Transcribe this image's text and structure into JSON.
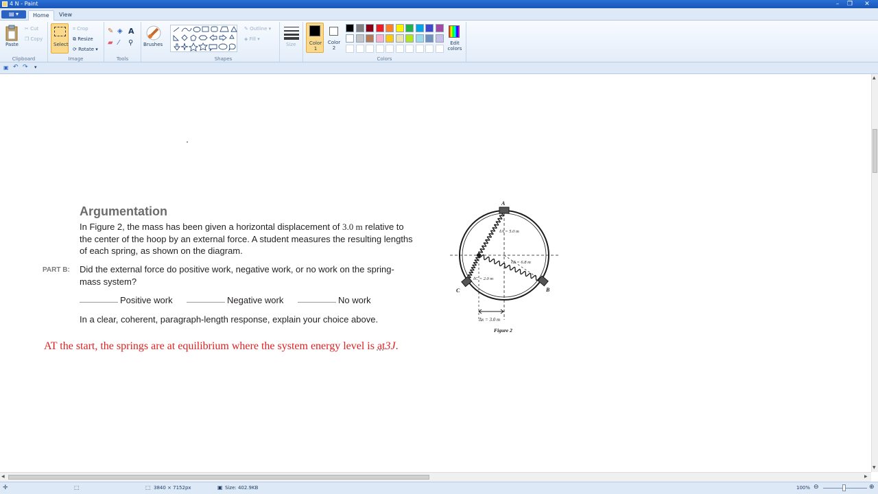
{
  "window": {
    "title": "4 N - Paint"
  },
  "tabs": [
    "Home",
    "View"
  ],
  "ribbon": {
    "clipboard": {
      "paste": "Paste",
      "cut": "Cut",
      "copy": "Copy",
      "label": "Clipboard"
    },
    "image": {
      "select": "Select",
      "crop": "Crop",
      "resize": "Resize",
      "rotate": "Rotate",
      "label": "Image"
    },
    "tools": {
      "label": "Tools"
    },
    "brushes": {
      "label": "Brushes"
    },
    "shapes": {
      "outline": "Outline",
      "fill": "Fill",
      "label": "Shapes"
    },
    "size": {
      "label": "Size"
    },
    "colors": {
      "color1": "Color 1",
      "color2": "Color 2",
      "edit": "Edit colors",
      "label": "Colors",
      "color1_value": "#000000",
      "color2_value": "#ffffff",
      "palette_row1": [
        "#000000",
        "#7f7f7f",
        "#880015",
        "#ed1c24",
        "#ff7f27",
        "#fff200",
        "#22b14c",
        "#00a2e8",
        "#3f48cc",
        "#a349a4"
      ],
      "palette_row2": [
        "#ffffff",
        "#c3c3c3",
        "#b97a57",
        "#ffaec9",
        "#ffc90e",
        "#efe4b0",
        "#b5e61d",
        "#99d9ea",
        "#7092be",
        "#c8bfe7"
      ]
    }
  },
  "document": {
    "heading": "Argumentation",
    "paragraph1": {
      "before": "In Figure 2, the mass has been given a horizontal displacement of",
      "value": "3.0 m",
      "after": "relative to",
      "line2": "the center of the hoop by an external force. A student measures the resulting lengths",
      "line3": "of each spring, as shown on the diagram."
    },
    "part_label": "PART B:",
    "question_line1": "Did the external force do positive work, negative work, or no work on the spring-",
    "question_line2": "mass system?",
    "options": [
      "Positive work",
      "Negative work",
      "No work"
    ],
    "instruction": "In a clear, coherent, paragraph-length response, explain your choice above.",
    "answer": {
      "before": "AT the start, the springs are at equilibrium where the system energy level is",
      "underlined": "at",
      "value": "3J",
      "after": "."
    },
    "figure": {
      "labels": [
        "A",
        "B",
        "C"
      ],
      "lengths": [
        "ℓA = 5.0 m",
        "ℓB = 6.8 m",
        "ℓC = 2.0 m"
      ],
      "displacement": "Δx = 3.0 m",
      "caption": "Figure 2"
    }
  },
  "status": {
    "dimensions": "3840 × 7152px",
    "size": "Size: 402.9KB",
    "zoom": "100%"
  }
}
